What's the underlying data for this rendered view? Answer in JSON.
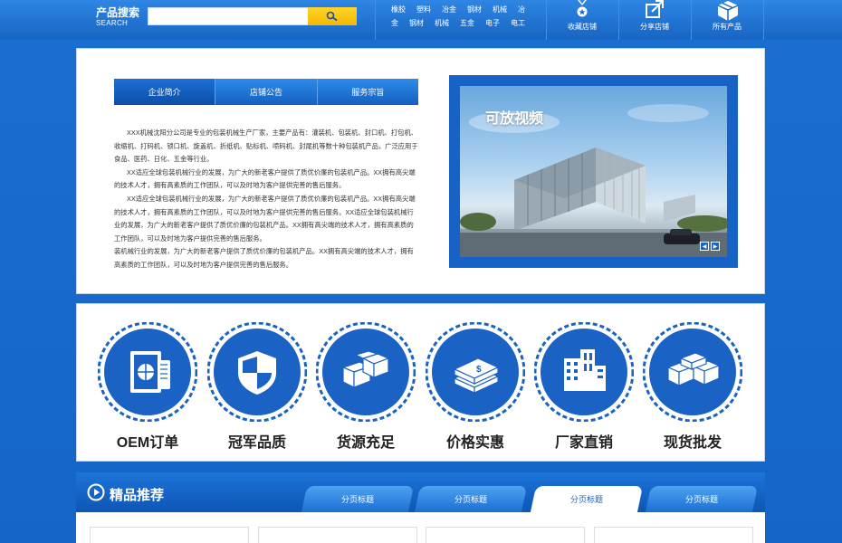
{
  "search": {
    "label": "产品搜索",
    "label_en": "SEARCH",
    "placeholder": ""
  },
  "categories": {
    "row1": [
      "橡胶",
      "塑料",
      "冶金",
      "钢材",
      "机械",
      "冶"
    ],
    "row2": [
      "金",
      "钢材",
      "机械",
      "五金",
      "电子",
      "电工"
    ]
  },
  "actions": {
    "favorite": "收藏店铺",
    "share": "分享店铺",
    "all_products": "所有产品"
  },
  "intro_tabs": [
    "企业简介",
    "店铺公告",
    "服务宗旨"
  ],
  "intro_paragraphs": [
    "XXX机械沈阳分公司是专业的包装机械生产厂家，主要产品有：灌装机、包装机、封口机、打包机、收缩机、打码机、锁口机、旋盖机、折纸机、贴标机、喷码机、封尾机等数十种包装机产品，广泛应用于食品、医药、日化、五金等行业。",
    "XX适应全球包装机械行业的发展，为广大的新老客户提供了质优价廉的包装机产品。XX拥有高尖端的技术人才，拥有高素质的工作团队，可以及时地为客户提供完善的售后服务。",
    "XX适应全球包装机械行业的发展，为广大的新老客户提供了质优价廉的包装机产品。XX拥有高尖端的技术人才，拥有高素质的工作团队，可以及时地为客户提供完善的售后服务。XX适应全球包装机械行业的发展，为广大的新老客户提供了质优价廉的包装机产品。XX拥有高尖端的技术人才，拥有高素质的工作团队，可以及时地为客户提供完善的售后服务。",
    "装机械行业的发展，为广大的新老客户提供了质优价廉的包装机产品。XX拥有高尖端的技术人才，拥有高素质的工作团队，可以及时地为客户提供完善的售后服务。"
  ],
  "video": {
    "title": "可放视频",
    "prev": "◀",
    "next": "▶"
  },
  "features": [
    "OEM订单",
    "冠军品质",
    "货源充足",
    "价格实惠",
    "厂家直销",
    "现货批发"
  ],
  "recommend": {
    "title": "精品推荐",
    "tabs": [
      "分页标题",
      "分页标题",
      "分页标题",
      "分页标题"
    ],
    "active_tab": 2
  },
  "colors": {
    "brand_blue": "#1565c8",
    "search_button": "#f4b800",
    "feature_badge": "#1a62c4"
  }
}
